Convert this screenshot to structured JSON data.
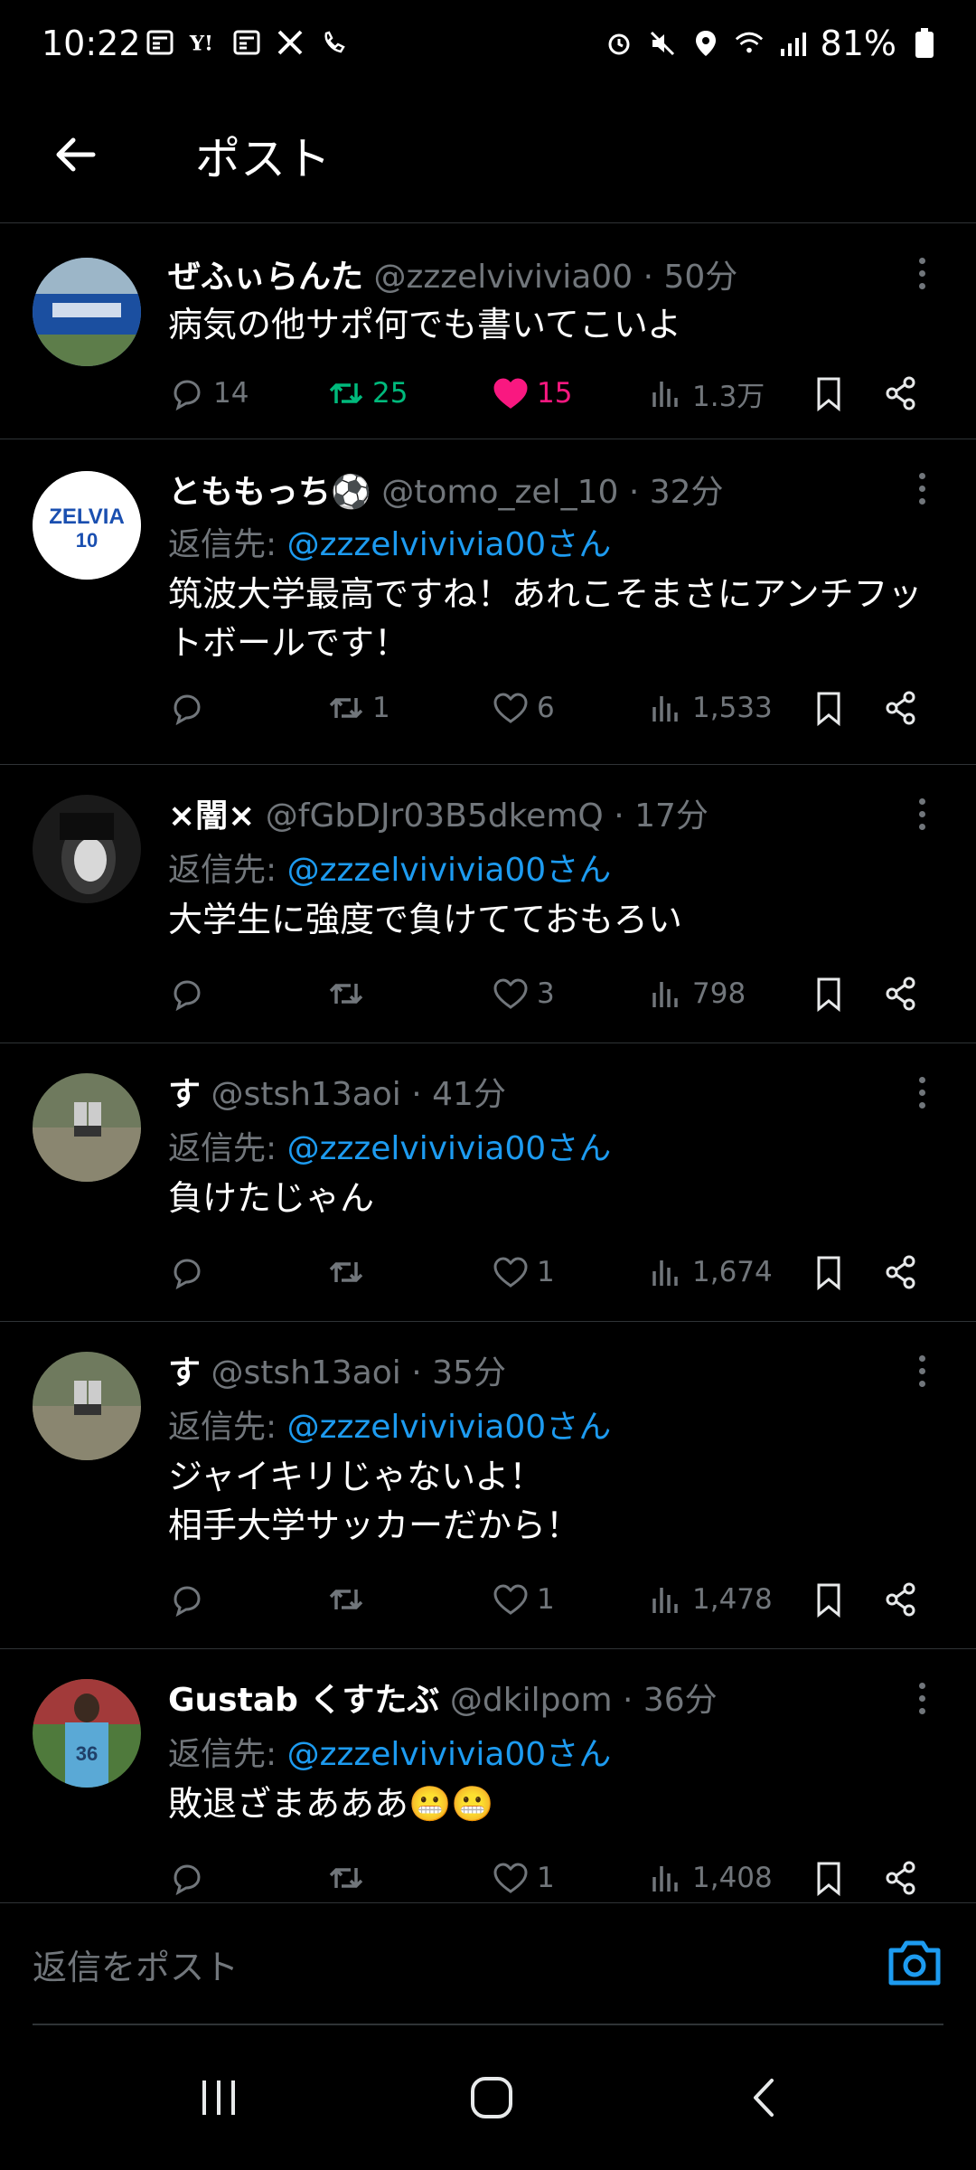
{
  "status_bar": {
    "time": "10:22",
    "battery": "81%"
  },
  "header": {
    "title": "ポスト"
  },
  "posts": [
    {
      "name": "ぜふぃらんた",
      "handle": "@zzzelvivivia00",
      "time": "· 50分",
      "reply_to_prefix": "",
      "reply_to_user": "",
      "text": "病気の他サポ何でも書いてこいよ",
      "replies": "14",
      "reposts": "25",
      "likes": "15",
      "views": "1.3万"
    },
    {
      "name": "とももっち⚽",
      "handle": "@tomo_zel_10",
      "time": "· 32分",
      "reply_to_prefix": "返信先: ",
      "reply_to_user": "@zzzelvivivia00さん",
      "text": "筑波大学最高ですね！あれこそまさにアンチフッ\nトボールです！",
      "replies": "",
      "reposts": "1",
      "likes": "6",
      "views": "1,533"
    },
    {
      "name": "×闇×",
      "handle": "@fGbDJr03B5dkemQ",
      "time": "· 17分",
      "reply_to_prefix": "返信先: ",
      "reply_to_user": "@zzzelvivivia00さん",
      "text": "大学生に強度で負けてておもろい",
      "replies": "",
      "reposts": "",
      "likes": "3",
      "views": "798"
    },
    {
      "name": "す",
      "handle": "@stsh13aoi",
      "time": "· 41分",
      "reply_to_prefix": "返信先: ",
      "reply_to_user": "@zzzelvivivia00さん",
      "text": "負けたじゃん",
      "replies": "",
      "reposts": "",
      "likes": "1",
      "views": "1,674"
    },
    {
      "name": "す",
      "handle": "@stsh13aoi",
      "time": "· 35分",
      "reply_to_prefix": "返信先: ",
      "reply_to_user": "@zzzelvivivia00さん",
      "text": "ジャイキリじゃないよ！\n相手大学サッカーだから！",
      "replies": "",
      "reposts": "",
      "likes": "1",
      "views": "1,478"
    },
    {
      "name": "Gustab くすたぶ",
      "handle": "@dkilpom",
      "time": "· 36分",
      "reply_to_prefix": "返信先: ",
      "reply_to_user": "@zzzelvivivia00さん",
      "text": "敗退ざまあああ😬😬",
      "replies": "",
      "reposts": "",
      "likes": "1",
      "views": "1,408"
    }
  ],
  "avatar_badges": {
    "zelvia": "ZELVIA",
    "zelvia_num": "10",
    "jersey": "36"
  },
  "reply_bar": {
    "placeholder": "返信をポスト"
  },
  "colors": {
    "accent": "#1d9bf0",
    "repost_active": "#00ba7c",
    "like_active": "#f91880",
    "muted": "#71767b"
  },
  "icons": [
    "reply-icon",
    "repost-icon",
    "like-icon",
    "views-icon",
    "bookmark-icon",
    "share-icon",
    "camera-icon",
    "back-arrow-icon",
    "more-icon"
  ]
}
